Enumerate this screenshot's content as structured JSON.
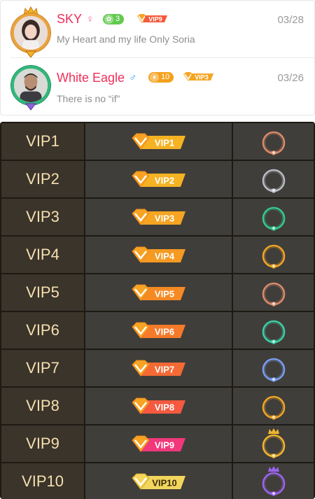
{
  "users": [
    {
      "name": "SKY",
      "gender_symbol": "♀",
      "level": "3",
      "vip": "VIP9",
      "date": "03/28",
      "message": "My Heart and my life Only Soria",
      "accent": "#e9a33c"
    },
    {
      "name": "White Eagle",
      "gender_symbol": "♂",
      "level": "10",
      "vip": "VIP3",
      "date": "03/26",
      "message": "There is no “if”",
      "accent": "#2fb87a"
    }
  ],
  "vip_levels": [
    {
      "label": "VIP1",
      "badge": "VIP1",
      "badge_color": "#f5b324",
      "frame_color": "#d98a6a"
    },
    {
      "label": "VIP2",
      "badge": "VIP2",
      "badge_color": "#f5b324",
      "frame_color": "#b9bcc4"
    },
    {
      "label": "VIP3",
      "badge": "VIP3",
      "badge_color": "#f5a522",
      "frame_color": "#35c98e"
    },
    {
      "label": "VIP4",
      "badge": "VIP4",
      "badge_color": "#f59a22",
      "frame_color": "#f0a526"
    },
    {
      "label": "VIP5",
      "badge": "VIP5",
      "badge_color": "#f58a24",
      "frame_color": "#d98a6a"
    },
    {
      "label": "VIP6",
      "badge": "VIP6",
      "badge_color": "#f57a2a",
      "frame_color": "#3ccfa6"
    },
    {
      "label": "VIP7",
      "badge": "VIP7",
      "badge_color": "#f56a34",
      "frame_color": "#7a9cf0"
    },
    {
      "label": "VIP8",
      "badge": "VIP8",
      "badge_color": "#f55a40",
      "frame_color": "#f0a526"
    },
    {
      "label": "VIP9",
      "badge": "VIP9",
      "badge_color": "#f0387a",
      "frame_color": "#f0b52e"
    },
    {
      "label": "VIP10",
      "badge": "VIP10",
      "badge_color": "#f2d65c",
      "frame_color": "#9b63f0"
    }
  ]
}
